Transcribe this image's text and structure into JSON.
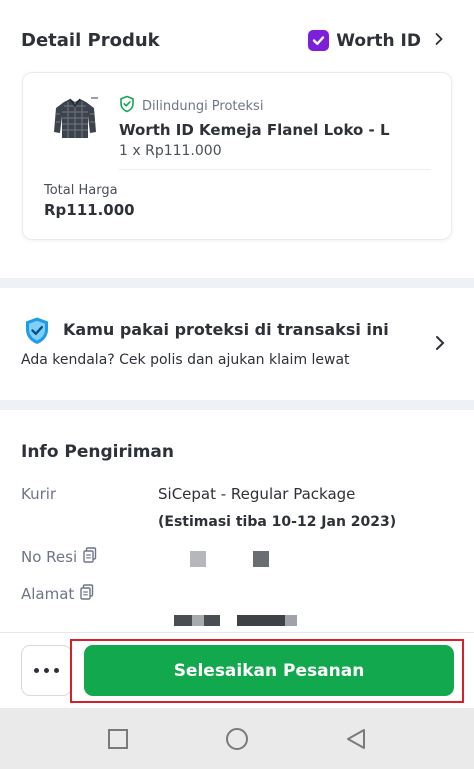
{
  "detail": {
    "title": "Detail Produk",
    "shop_name": "Worth ID",
    "protection_label": "Dilindungi Proteksi",
    "product_name": "Worth ID Kemeja Flanel Loko - L",
    "product_qty_price": "1 x Rp111.000",
    "total_label": "Total Harga",
    "total_value": "Rp111.000"
  },
  "protection": {
    "title": "Kamu pakai proteksi di transaksi ini",
    "subtitle": "Ada kendala? Cek polis dan ajukan klaim lewat"
  },
  "shipping": {
    "title": "Info Pengiriman",
    "courier_label": "Kurir",
    "courier_value": "SiCepat - Regular Package",
    "estimate": "(Estimasi tiba 10-12 Jan 2023)",
    "resi_label": "No Resi",
    "address_label": "Alamat"
  },
  "bottom": {
    "cta_label": "Selesaikan Pesanan"
  },
  "colors": {
    "accent_green": "#12a84e",
    "shop_purple": "#7b1fd8",
    "highlight_red": "#d8202b",
    "shield_blue": "#1e9be9"
  },
  "icons": {
    "shop": "shop-badge-icon",
    "protect": "shield-check-icon",
    "copy": "copy-icon",
    "more": "more-dots-icon"
  }
}
